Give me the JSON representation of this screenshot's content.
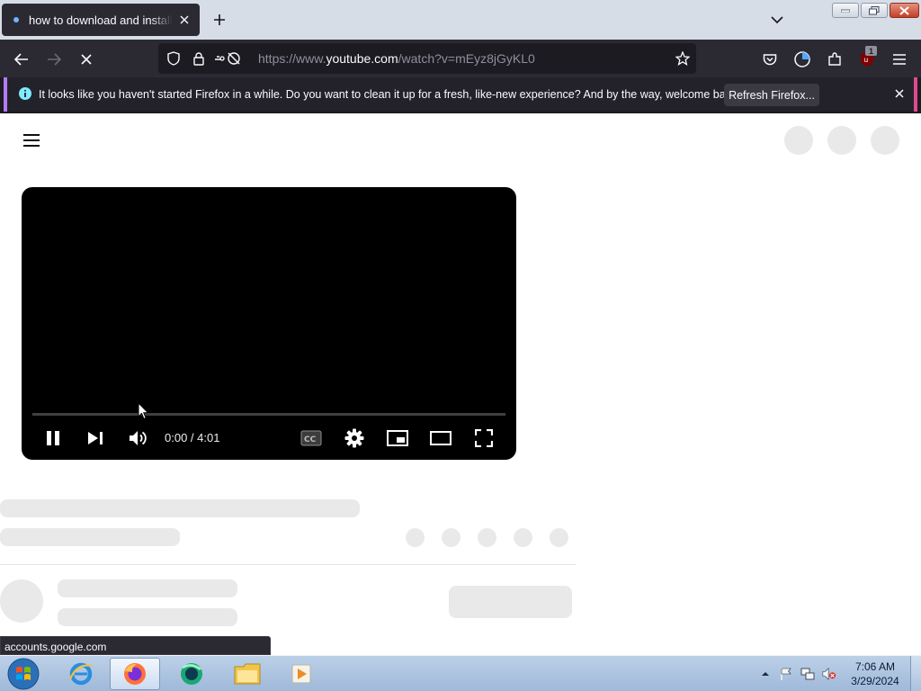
{
  "browser": {
    "tab_title": "how to download and install ad",
    "url_prefix": "https://www.",
    "url_domain": "youtube.com",
    "url_suffix": "/watch?v=mEyz8jGyKL0",
    "extension_badge": "1"
  },
  "notification": {
    "message": "It looks like you haven't started Firefox in a while. Do you want to clean it up for a fresh, like-new experience? And by the way, welcome back!",
    "button_label": "Refresh Firefox..."
  },
  "player": {
    "time_display": "0:00 / 4:01",
    "progress": 0
  },
  "status_tip": "accounts.google.com",
  "taskbar": {
    "time": "7:06 AM",
    "date": "3/29/2024"
  },
  "colors": {
    "toolbar": "#2b2a33",
    "tab_strip": "#d7dde7",
    "player_bg": "#000000",
    "placeholder": "#e9e9e9",
    "progress_played": "#ff0000"
  },
  "icons": [
    "firefox-favicon",
    "close-icon",
    "plus-icon",
    "chevron-down-icon",
    "back-arrow-icon",
    "forward-arrow-icon",
    "stop-icon",
    "shield-icon",
    "lock-icon",
    "permissions-icon",
    "star-icon",
    "pocket-icon",
    "account-icon",
    "extensions-icon",
    "ublock-icon",
    "hamburger-menu-icon",
    "info-icon",
    "pause-icon",
    "next-icon",
    "volume-icon",
    "cc-icon",
    "settings-gear-icon",
    "miniplayer-icon",
    "theater-icon",
    "fullscreen-icon"
  ]
}
